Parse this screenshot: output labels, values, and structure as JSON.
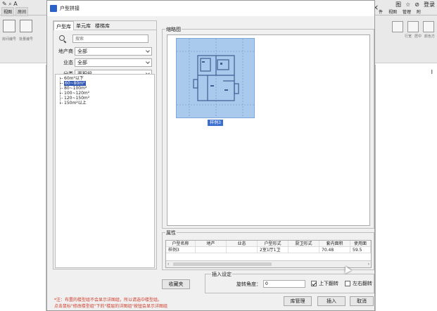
{
  "background_app": {
    "left_toolbar": {
      "quick_icons": "✎ ⌕ A",
      "tabs": [
        "视图",
        "房间"
      ],
      "icon_labels": [
        "房间编号",
        "批量编号"
      ]
    },
    "right_toolbar": {
      "quick": [
        "图",
        "☆",
        "⊘",
        "登录"
      ],
      "tabs": [
        "件",
        "视图",
        "管理",
        "附"
      ],
      "icon_labels": [
        "行宽",
        "居中",
        "颜色方"
      ],
      "mark": "I"
    },
    "close_glyph": "×"
  },
  "dialog": {
    "title": "户型拼接",
    "tabs": [
      "户型库",
      "单元库",
      "楼梯库"
    ],
    "active_tab_index": 0,
    "search": {
      "placeholder": "搜索",
      "value": ""
    },
    "filters": [
      {
        "label": "地产商",
        "value": "全部"
      },
      {
        "label": "业态",
        "value": "全部"
      },
      {
        "label": "分类",
        "value": "面积段"
      }
    ],
    "tree": [
      {
        "label": "60m²以下",
        "selected": false
      },
      {
        "label": "60~80m²",
        "selected": true
      },
      {
        "label": "80~100m²",
        "selected": false
      },
      {
        "label": "100~120m²",
        "selected": false
      },
      {
        "label": "120~150m²",
        "selected": false
      },
      {
        "label": "150m²以上",
        "selected": false
      }
    ],
    "thumbnails_group_label": "缩略图",
    "thumbnail": {
      "label": "样例3",
      "fill": "#a9c9ed",
      "selected": true
    },
    "properties": {
      "group_label": "属性",
      "columns": [
        "户型名称",
        "地产",
        "业态",
        "户型形式",
        "厨卫形式",
        "套内面积",
        "使用面"
      ],
      "rows": [
        [
          "样例3",
          "",
          "",
          "2室1厅1卫",
          "",
          "70.48",
          "59.5"
        ]
      ]
    },
    "insert_settings": {
      "group_label": "插入设定",
      "angle_label": "旋转角度：",
      "angle_value": "0",
      "flip_vertical_label": "上下翻转",
      "flip_vertical_checked": true,
      "flip_horizontal_label": "左右翻转",
      "flip_horizontal_checked": false
    },
    "buttons": {
      "favorite": "收藏夹",
      "library_manage": "库管理",
      "insert": "插入",
      "cancel": "取消"
    },
    "notes": [
      "*注：布置的楼型组不会显示详图组，所以请选中楼型组。",
      "点击鼠标\"修改楼型组\"下的\"楼层的详图组\"按钮会显示详图组"
    ]
  }
}
